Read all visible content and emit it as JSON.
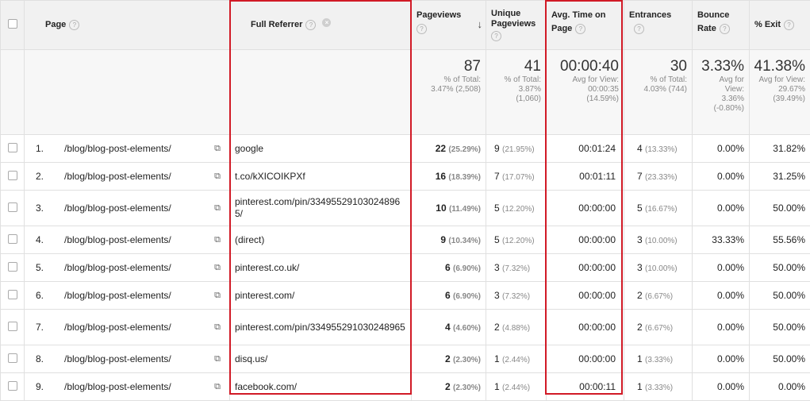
{
  "headers": {
    "page": "Page",
    "full_referrer": "Full Referrer",
    "pageviews": "Pageviews",
    "unique_pageviews": "Unique Pageviews",
    "avg_time": "Avg. Time on Page",
    "entrances": "Entrances",
    "bounce_rate": "Bounce Rate",
    "exit": "% Exit"
  },
  "icons": {
    "help": "question-mark-icon",
    "remove": "remove-dimension-icon",
    "sort": "sort-descending-arrow-icon",
    "link": "open-in-new-window-icon"
  },
  "totals": {
    "pageviews": {
      "value": "87",
      "l1": "% of Total:",
      "l2": "3.47% (2,508)"
    },
    "unique": {
      "value": "41",
      "l1": "% of Total:",
      "l2": "3.87%",
      "l3": "(1,060)"
    },
    "avg_time": {
      "value": "00:00:40",
      "l1": "Avg for View:",
      "l2": "00:00:35",
      "l3": "(14.59%)"
    },
    "entrances": {
      "value": "30",
      "l1": "% of Total:",
      "l2": "4.03% (744)"
    },
    "bounce": {
      "value": "3.33%",
      "l1": "Avg for",
      "l2": "View:",
      "l3": "3.36%",
      "l4": "(-0.80%)"
    },
    "exit": {
      "value": "41.38%",
      "l1": "Avg for View:",
      "l2": "29.67%",
      "l3": "(39.49%)"
    }
  },
  "rows": [
    {
      "idx": "1.",
      "page": "/blog/blog-post-elements/",
      "ref": "google",
      "pv": "22",
      "pvp": "(25.29%)",
      "upv": "9",
      "upvp": "(21.95%)",
      "time": "00:01:24",
      "ent": "4",
      "entp": "(13.33%)",
      "bounce": "0.00%",
      "exit": "31.82%"
    },
    {
      "idx": "2.",
      "page": "/blog/blog-post-elements/",
      "ref": "t.co/kXICOIKPXf",
      "pv": "16",
      "pvp": "(18.39%)",
      "upv": "7",
      "upvp": "(17.07%)",
      "time": "00:01:11",
      "ent": "7",
      "entp": "(23.33%)",
      "bounce": "0.00%",
      "exit": "31.25%"
    },
    {
      "idx": "3.",
      "page": "/blog/blog-post-elements/",
      "ref": "pinterest.com/pin/334955291030248965/",
      "pv": "10",
      "pvp": "(11.49%)",
      "upv": "5",
      "upvp": "(12.20%)",
      "time": "00:00:00",
      "ent": "5",
      "entp": "(16.67%)",
      "bounce": "0.00%",
      "exit": "50.00%"
    },
    {
      "idx": "4.",
      "page": "/blog/blog-post-elements/",
      "ref": "(direct)",
      "pv": "9",
      "pvp": "(10.34%)",
      "upv": "5",
      "upvp": "(12.20%)",
      "time": "00:00:00",
      "ent": "3",
      "entp": "(10.00%)",
      "bounce": "33.33%",
      "exit": "55.56%"
    },
    {
      "idx": "5.",
      "page": "/blog/blog-post-elements/",
      "ref": "pinterest.co.uk/",
      "pv": "6",
      "pvp": "(6.90%)",
      "upv": "3",
      "upvp": "(7.32%)",
      "time": "00:00:00",
      "ent": "3",
      "entp": "(10.00%)",
      "bounce": "0.00%",
      "exit": "50.00%"
    },
    {
      "idx": "6.",
      "page": "/blog/blog-post-elements/",
      "ref": "pinterest.com/",
      "pv": "6",
      "pvp": "(6.90%)",
      "upv": "3",
      "upvp": "(7.32%)",
      "time": "00:00:00",
      "ent": "2",
      "entp": "(6.67%)",
      "bounce": "0.00%",
      "exit": "50.00%"
    },
    {
      "idx": "7.",
      "page": "/blog/blog-post-elements/",
      "ref": "pinterest.com/pin/334955291030248965",
      "pv": "4",
      "pvp": "(4.60%)",
      "upv": "2",
      "upvp": "(4.88%)",
      "time": "00:00:00",
      "ent": "2",
      "entp": "(6.67%)",
      "bounce": "0.00%",
      "exit": "50.00%"
    },
    {
      "idx": "8.",
      "page": "/blog/blog-post-elements/",
      "ref": "disq.us/",
      "pv": "2",
      "pvp": "(2.30%)",
      "upv": "1",
      "upvp": "(2.44%)",
      "time": "00:00:00",
      "ent": "1",
      "entp": "(3.33%)",
      "bounce": "0.00%",
      "exit": "50.00%"
    },
    {
      "idx": "9.",
      "page": "/blog/blog-post-elements/",
      "ref": "facebook.com/",
      "pv": "2",
      "pvp": "(2.30%)",
      "upv": "1",
      "upvp": "(2.44%)",
      "time": "00:00:11",
      "ent": "1",
      "entp": "(3.33%)",
      "bounce": "0.00%",
      "exit": "0.00%"
    }
  ],
  "highlight_color": "#d11a26"
}
